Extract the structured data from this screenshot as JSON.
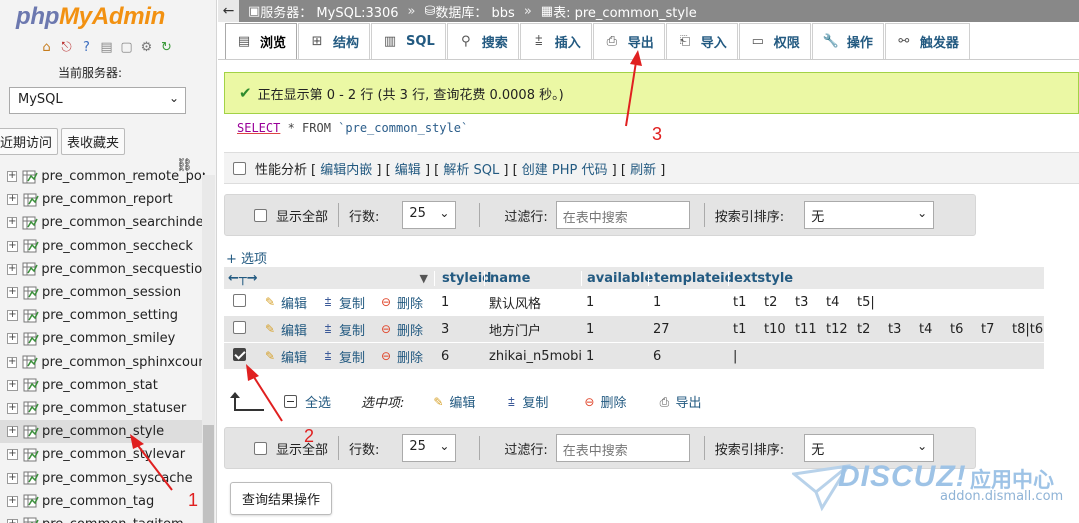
{
  "nav": {
    "logo_php": "php",
    "logo_rest": "MyAdmin",
    "server_label": "当前服务器:",
    "server_value": "MySQL",
    "tab_recent": "近期访问",
    "tab_favorites": "表收藏夹",
    "tables": [
      "pre_common_remote_port",
      "pre_common_report",
      "pre_common_searchindex",
      "pre_common_seccheck",
      "pre_common_secquestion",
      "pre_common_session",
      "pre_common_setting",
      "pre_common_smiley",
      "pre_common_sphinxcounter",
      "pre_common_stat",
      "pre_common_statuser",
      "pre_common_style",
      "pre_common_stylevar",
      "pre_common_syscache",
      "pre_common_tag",
      "pre_common_tagitem"
    ],
    "selected_table": "pre_common_style"
  },
  "breadcrumb": {
    "server": "服务器： MySQL:3306",
    "database": "数据库： bbs",
    "table": "表: pre_common_style"
  },
  "tabs": [
    "浏览",
    "结构",
    "SQL",
    "搜索",
    "插入",
    "导出",
    "导入",
    "权限",
    "操作",
    "触发器"
  ],
  "notice": "正在显示第 0 - 2 行 (共 3 行, 查询花费 0.0008 秒。)",
  "sql": {
    "select": "SELECT",
    "rest": " * FROM ",
    "table": "`pre_common_style`"
  },
  "perf": {
    "label": "性能分析",
    "links": [
      "编辑内嵌",
      "编辑",
      "解析 SQL",
      "创建 PHP 代码",
      "刷新"
    ]
  },
  "navbar": {
    "show_all": "显示全部",
    "rows_label": "行数:",
    "rows_value": "25",
    "filter_label": "过滤行:",
    "filter_placeholder": "在表中搜索",
    "sort_label": "按索引排序:",
    "sort_value": "无"
  },
  "options_link": "+ 选项",
  "table": {
    "columns": [
      "styleid",
      "name",
      "available",
      "templateid",
      "extstyle"
    ],
    "action_edit": "编辑",
    "action_copy": "复制",
    "action_delete": "删除",
    "rows": [
      {
        "styleid": "1",
        "name": "默认风格",
        "available": "1",
        "templateid": "1",
        "extstyle": [
          "t1",
          "t2",
          "t3",
          "t4",
          "t5|"
        ],
        "checked": false
      },
      {
        "styleid": "3",
        "name": "地方门户",
        "available": "1",
        "templateid": "27",
        "extstyle": [
          "t1",
          "t10",
          "t11",
          "t12",
          "t2",
          "t3",
          "t4",
          "t6",
          "t7",
          "t8|t6"
        ],
        "checked": false
      },
      {
        "styleid": "6",
        "name": "zhikai_n5mobi",
        "available": "1",
        "templateid": "6",
        "extstyle": [
          "|"
        ],
        "checked": true
      }
    ]
  },
  "selection": {
    "check_all": "全选",
    "with_selected": "选中项:",
    "edit": "编辑",
    "copy": "复制",
    "delete": "删除",
    "export": "导出"
  },
  "query_ops_button": "查询结果操作",
  "annotations": {
    "a1": "1",
    "a2": "2",
    "a3": "3"
  },
  "watermark": {
    "brand": "DISCUZ!",
    "cn": "应用中心",
    "url": "addon.dismall.com"
  }
}
